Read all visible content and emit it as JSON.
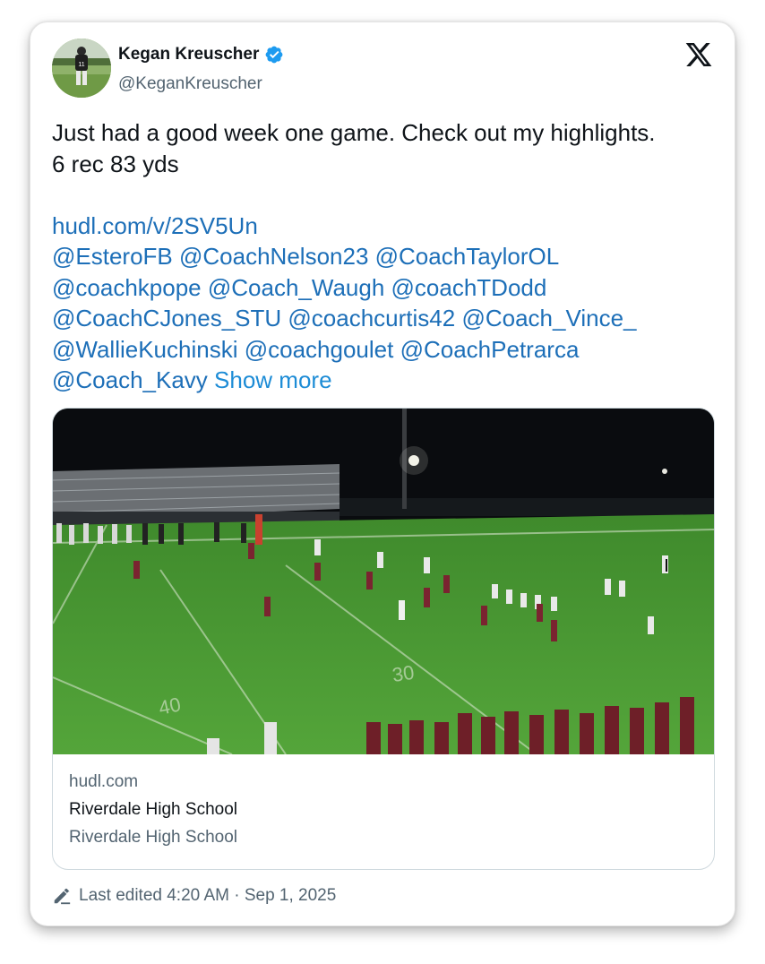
{
  "author": {
    "display_name": "Kegan Kreuscher",
    "handle": "@KeganKreuscher",
    "verified": true
  },
  "tweet": {
    "text_lines": [
      "Just had a good week one game. Check out my highlights.",
      "6 rec 83 yds"
    ],
    "link": "hudl.com/v/2SV5Un",
    "mentions_lines": [
      [
        "@EsteroFB",
        "@CoachNelson23",
        "@CoachTaylorOL"
      ],
      [
        "@coachkpope",
        "@Coach_Waugh",
        "@coachTDodd"
      ],
      [
        "@CoachCJones_STU",
        "@coachcurtis42",
        "@Coach_Vince_"
      ],
      [
        "@WallieKuchinski",
        "@coachgoulet",
        "@CoachPetrarca"
      ],
      [
        "@Coach_Kavy"
      ]
    ],
    "show_more": "Show more"
  },
  "link_card": {
    "domain": "hudl.com",
    "title": "Riverdale High School",
    "description": "Riverdale High School"
  },
  "footer": {
    "edited_label": "Last edited 4:20 AM · Sep 1, 2025"
  },
  "icons": {
    "brand": "x-logo-icon",
    "verified": "verified-badge-icon",
    "edit": "pencil-icon"
  },
  "colors": {
    "link": "#1d6fb8",
    "verified": "#1d9bf0",
    "muted": "#536471",
    "text": "#0f1419"
  }
}
